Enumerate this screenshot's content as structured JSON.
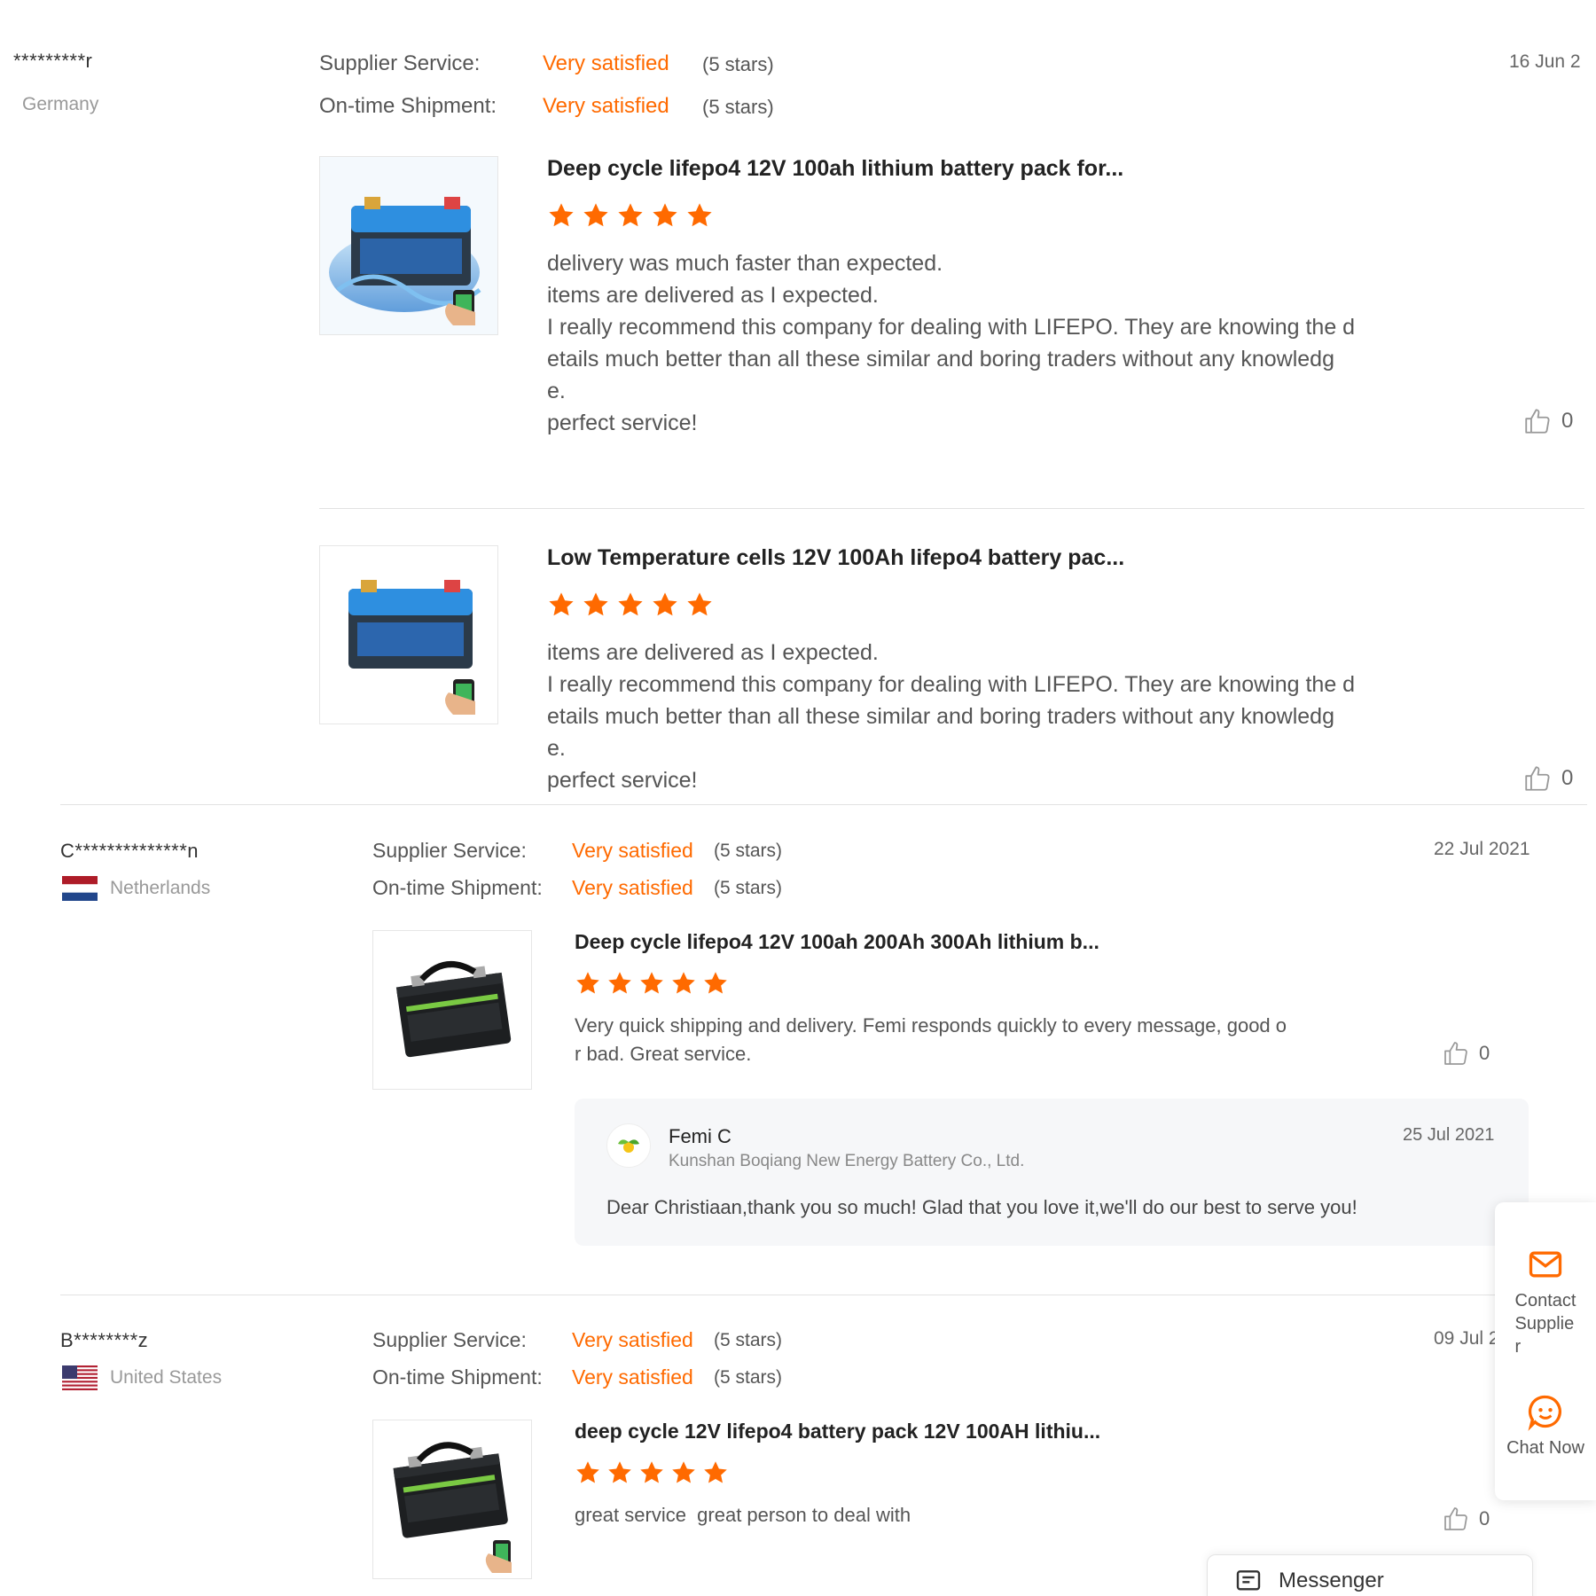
{
  "reviews": [
    {
      "user": "*********r",
      "country": "Germany",
      "flag": "none",
      "supplier_service_label": "Supplier Service:",
      "supplier_service_value": "Very satisfied",
      "supplier_service_stars": "(5 stars)",
      "shipment_label": "On-time Shipment:",
      "shipment_value": "Very satisfied",
      "shipment_stars": "(5 stars)",
      "date": "16 Jun 2",
      "items": [
        {
          "title": "Deep cycle lifepo4 12V 100ah lithium battery pack for...",
          "rating": 5,
          "text": "delivery was much faster than expected.\nitems are delivered as I expected.\nI really recommend this company for dealing with LIFEPO. They are knowing the d\netails much better than all these similar and boring traders without any knowledg\ne.\nperfect service!",
          "likes": "0",
          "thumb_icon": "battery-water-phone-image"
        },
        {
          "title": "Low Temperature cells 12V 100Ah lifepo4 battery pac...",
          "rating": 5,
          "text": "items are delivered as I expected.\nI really recommend this company for dealing with LIFEPO. They are knowing the d\netails much better than all these similar and boring traders without any knowledg\ne.\nperfect service!",
          "likes": "0",
          "thumb_icon": "battery-phone-image"
        }
      ]
    },
    {
      "user": "C**************n",
      "country": "Netherlands",
      "flag": "netherlands-flag",
      "supplier_service_label": "Supplier Service:",
      "supplier_service_value": "Very satisfied",
      "supplier_service_stars": "(5 stars)",
      "shipment_label": "On-time Shipment:",
      "shipment_value": "Very satisfied",
      "shipment_stars": "(5 stars)",
      "date": "22 Jul 2021",
      "items": [
        {
          "title": "Deep cycle lifepo4 12V 100ah 200Ah 300Ah lithium b...",
          "rating": 5,
          "text": "Very quick shipping and delivery. Femi responds quickly to every message, good o\nr bad. Great service.",
          "likes": "0",
          "thumb_icon": "black-battery-image"
        }
      ],
      "reply": {
        "name": "Femi C",
        "company": "Kunshan Boqiang New Energy Battery Co., Ltd.",
        "date": "25 Jul 2021",
        "text": "Dear Christiaan,thank you so much! Glad that you love it,we'll do our best to serve you!"
      }
    },
    {
      "user": "B********z",
      "country": "United States",
      "flag": "usa-flag",
      "supplier_service_label": "Supplier Service:",
      "supplier_service_value": "Very satisfied",
      "supplier_service_stars": "(5 stars)",
      "shipment_label": "On-time Shipment:",
      "shipment_value": "Very satisfied",
      "shipment_stars": "(5 stars)",
      "date": "09 Jul 2",
      "items": [
        {
          "title": "deep cycle 12V lifepo4 battery pack 12V 100AH lithiu...",
          "rating": 5,
          "text": "great service  great person to deal with",
          "likes": "0",
          "thumb_icon": "black-battery-phone-image"
        }
      ]
    }
  ],
  "side_panel": {
    "contact_label": "Contact\nSupplie\nr",
    "chat_label": "Chat Now"
  },
  "messenger": {
    "label": "Messenger"
  },
  "colors": {
    "accent": "#ff6a00",
    "star": "#ff6a00",
    "divider": "#e2e2e2"
  }
}
